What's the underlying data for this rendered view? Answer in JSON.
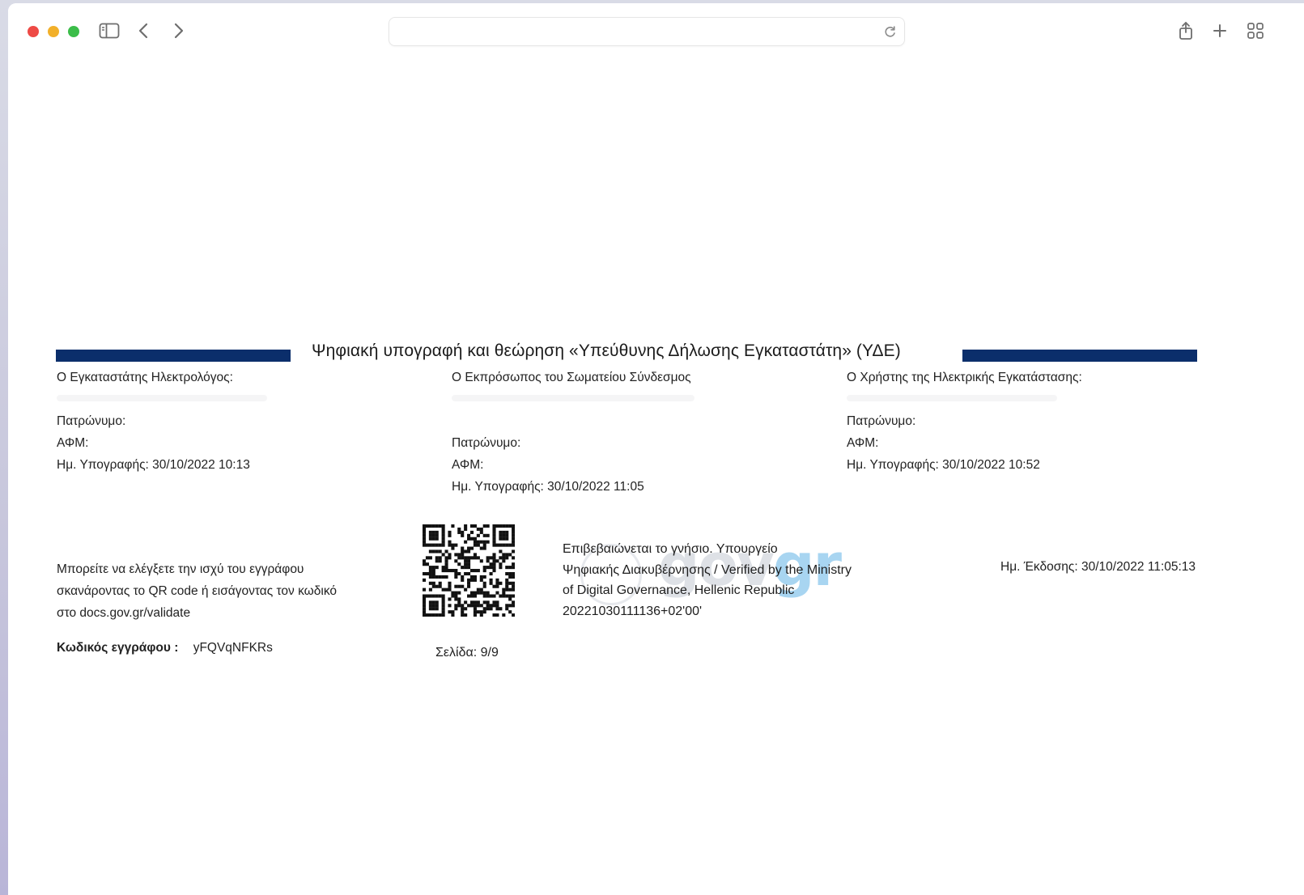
{
  "browser": {
    "address": "",
    "icons": {
      "sidebar": "sidebar-icon",
      "back": "chevron-left-icon",
      "forward": "chevron-right-icon",
      "reload": "reload-icon",
      "share": "share-icon",
      "new_tab": "plus-icon",
      "tab_overview": "tab-overview-icon"
    },
    "colors": {
      "close": "#ee4a45",
      "minimize": "#f2b02a",
      "zoom": "#3bbd49"
    }
  },
  "document": {
    "title": "Ψηφιακή υπογραφή και θεώρηση «Υπεύθυνης Δήλωσης Εγκαταστάτη» (ΥΔΕ)",
    "accent_color": "#0b2e6b",
    "installer": {
      "heading": "Ο Εγκαταστάτης Ηλεκτρολόγος:",
      "patronymic": "Πατρώνυμο:",
      "afm": "ΑΦΜ:",
      "signature_date": "Ημ. Υπογραφής: 30/10/2022 10:13"
    },
    "association": {
      "heading": "Ο Εκπρόσωπος του Σωματείου Σύνδεσμος",
      "patronymic": "Πατρώνυμο:",
      "afm": "ΑΦΜ:",
      "signature_date": "Ημ. Υπογραφής: 30/10/2022 11:05"
    },
    "user": {
      "heading": "Ο Χρήστης της Ηλεκτρικής Εγκατάστασης:",
      "patronymic": "Πατρώνυμο:",
      "afm": "ΑΦΜ:",
      "signature_date": "Ημ. Υπογραφής: 30/10/2022 10:52"
    },
    "validation_info": {
      "line1": "Μπορείτε να ελέγξετε την ισχύ του εγγράφου",
      "line2": "σκανάροντας το QR code ή εισάγοντας τον κωδικό",
      "line3": "στο docs.gov.gr/validate"
    },
    "document_code": {
      "label": "Κωδικός εγγράφου :",
      "value": "yFQVqNFKRs"
    },
    "page_number": "Σελίδα: 9/9",
    "verification": {
      "line1": "Επιβεβαιώνεται το γνήσιο. Υπουργείο",
      "line2": "Ψηφιακής Διακυβέρνησης / Verified by the Ministry",
      "line3": "of Digital Governance, Hellenic Republic",
      "line4": "20221030111136+02'00'",
      "watermark_gov": "gov",
      "watermark_gr": "gr"
    },
    "issue_date": "Ημ. Έκδοσης: 30/10/2022 11:05:13"
  }
}
